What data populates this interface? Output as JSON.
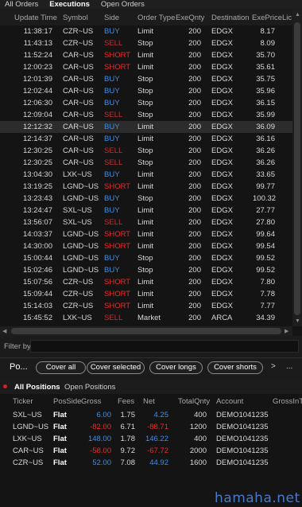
{
  "top_tabs": [
    "All Orders",
    "Executions",
    "Open Orders"
  ],
  "exec_headers": {
    "time": "Update Time",
    "symbol": "Symbol",
    "side": "Side",
    "type": "Order Type",
    "qty": "ExeQnty",
    "dest": "Destination",
    "price": "ExePrice",
    "li": "Lic"
  },
  "executions": [
    {
      "time": "11:38:17",
      "symbol": "CZR~US",
      "side": "BUY",
      "type": "Limit",
      "qty": "200",
      "dest": "EDGX",
      "price": "8.17"
    },
    {
      "time": "11:43:13",
      "symbol": "CZR~US",
      "side": "SELL",
      "type": "Stop",
      "qty": "200",
      "dest": "EDGX",
      "price": "8.09"
    },
    {
      "time": "11:52:24",
      "symbol": "CAR~US",
      "side": "SHORT",
      "type": "Limit",
      "qty": "200",
      "dest": "EDGX",
      "price": "35.70"
    },
    {
      "time": "12:00:23",
      "symbol": "CAR~US",
      "side": "SHORT",
      "type": "Limit",
      "qty": "200",
      "dest": "EDGX",
      "price": "35.61"
    },
    {
      "time": "12:01:39",
      "symbol": "CAR~US",
      "side": "BUY",
      "type": "Stop",
      "qty": "200",
      "dest": "EDGX",
      "price": "35.75"
    },
    {
      "time": "12:02:44",
      "symbol": "CAR~US",
      "side": "BUY",
      "type": "Stop",
      "qty": "200",
      "dest": "EDGX",
      "price": "35.96"
    },
    {
      "time": "12:06:30",
      "symbol": "CAR~US",
      "side": "BUY",
      "type": "Stop",
      "qty": "200",
      "dest": "EDGX",
      "price": "36.15"
    },
    {
      "time": "12:09:04",
      "symbol": "CAR~US",
      "side": "SELL",
      "type": "Stop",
      "qty": "200",
      "dest": "EDGX",
      "price": "35.99"
    },
    {
      "time": "12:12:32",
      "symbol": "CAR~US",
      "side": "BUY",
      "type": "Limit",
      "qty": "200",
      "dest": "EDGX",
      "price": "36.09"
    },
    {
      "time": "12:14:37",
      "symbol": "CAR~US",
      "side": "BUY",
      "type": "Limit",
      "qty": "200",
      "dest": "EDGX",
      "price": "36.16"
    },
    {
      "time": "12:30:25",
      "symbol": "CAR~US",
      "side": "SELL",
      "type": "Stop",
      "qty": "200",
      "dest": "EDGX",
      "price": "36.26"
    },
    {
      "time": "12:30:25",
      "symbol": "CAR~US",
      "side": "SELL",
      "type": "Stop",
      "qty": "200",
      "dest": "EDGX",
      "price": "36.26"
    },
    {
      "time": "13:04:30",
      "symbol": "LXK~US",
      "side": "BUY",
      "type": "Limit",
      "qty": "200",
      "dest": "EDGX",
      "price": "33.65"
    },
    {
      "time": "13:19:25",
      "symbol": "LGND~US",
      "side": "SHORT",
      "type": "Limit",
      "qty": "200",
      "dest": "EDGX",
      "price": "99.77"
    },
    {
      "time": "13:23:43",
      "symbol": "LGND~US",
      "side": "BUY",
      "type": "Stop",
      "qty": "200",
      "dest": "EDGX",
      "price": "100.32"
    },
    {
      "time": "13:24:47",
      "symbol": "SXL~US",
      "side": "BUY",
      "type": "Limit",
      "qty": "200",
      "dest": "EDGX",
      "price": "27.77"
    },
    {
      "time": "13:56:07",
      "symbol": "SXL~US",
      "side": "SELL",
      "type": "Limit",
      "qty": "200",
      "dest": "EDGX",
      "price": "27.80"
    },
    {
      "time": "14:03:37",
      "symbol": "LGND~US",
      "side": "SHORT",
      "type": "Limit",
      "qty": "200",
      "dest": "EDGX",
      "price": "99.64"
    },
    {
      "time": "14:30:00",
      "symbol": "LGND~US",
      "side": "SHORT",
      "type": "Limit",
      "qty": "200",
      "dest": "EDGX",
      "price": "99.54"
    },
    {
      "time": "15:00:44",
      "symbol": "LGND~US",
      "side": "BUY",
      "type": "Stop",
      "qty": "200",
      "dest": "EDGX",
      "price": "99.52"
    },
    {
      "time": "15:02:46",
      "symbol": "LGND~US",
      "side": "BUY",
      "type": "Stop",
      "qty": "200",
      "dest": "EDGX",
      "price": "99.52"
    },
    {
      "time": "15:07:56",
      "symbol": "CZR~US",
      "side": "SHORT",
      "type": "Limit",
      "qty": "200",
      "dest": "EDGX",
      "price": "7.80"
    },
    {
      "time": "15:09:44",
      "symbol": "CZR~US",
      "side": "SHORT",
      "type": "Limit",
      "qty": "200",
      "dest": "EDGX",
      "price": "7.78"
    },
    {
      "time": "15:14:03",
      "symbol": "CZR~US",
      "side": "SHORT",
      "type": "Limit",
      "qty": "200",
      "dest": "EDGX",
      "price": "7.77"
    },
    {
      "time": "15:45:52",
      "symbol": "LXK~US",
      "side": "SELL",
      "type": "Market",
      "qty": "200",
      "dest": "ARCA",
      "price": "34.39"
    }
  ],
  "filter": {
    "label": "Filter by",
    "value": ""
  },
  "toolbar": {
    "title": "Po...",
    "buttons": [
      "Cover all",
      "Cover selected",
      "Cover longs",
      "Cover shorts"
    ],
    "nav_next": ">",
    "overflow": "..."
  },
  "pos_tabs": [
    "All Positions",
    "Open Positions"
  ],
  "pos_headers": {
    "ticker": "Ticker",
    "posside": "PosSide",
    "gross": "Gross",
    "fees": "Fees",
    "net": "Net",
    "tq": "TotalQnty",
    "acct": "Account",
    "gin": "GrossInT"
  },
  "positions": [
    {
      "ticker": "SXL~US",
      "side": "Flat",
      "gross": "6.00",
      "fees": "1.75",
      "net": "4.25",
      "tq": "400",
      "acct": "DEMO1041235",
      "sign": "pos"
    },
    {
      "ticker": "LGND~US",
      "side": "Flat",
      "gross": "-82.00",
      "fees": "6.71",
      "net": "-88.71",
      "tq": "1200",
      "acct": "DEMO1041235",
      "sign": "neg"
    },
    {
      "ticker": "LXK~US",
      "side": "Flat",
      "gross": "148.00",
      "fees": "1.78",
      "net": "146.22",
      "tq": "400",
      "acct": "DEMO1041235",
      "sign": "pos"
    },
    {
      "ticker": "CAR~US",
      "side": "Flat",
      "gross": "-58.00",
      "fees": "9.72",
      "net": "-67.72",
      "tq": "2000",
      "acct": "DEMO1041235",
      "sign": "neg"
    },
    {
      "ticker": "CZR~US",
      "side": "Flat",
      "gross": "52.00",
      "fees": "7.08",
      "net": "44.92",
      "tq": "1600",
      "acct": "DEMO1041235",
      "sign": "pos"
    }
  ],
  "watermark": "hamaha.net",
  "colors": {
    "buy": "#3d8ee8",
    "short": "#ee2a2a",
    "sell": "#b23535",
    "positive": "#3d8ee8",
    "negative": "#ee2a2a"
  }
}
